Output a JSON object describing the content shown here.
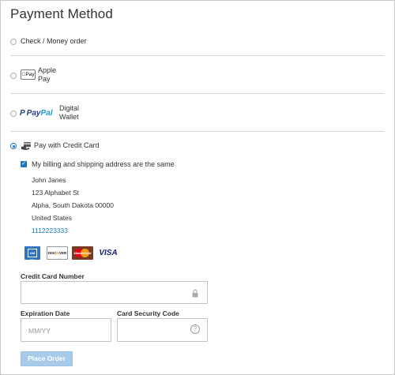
{
  "page": {
    "title": "Payment Method"
  },
  "methods": [
    {
      "label": "Check / Money order",
      "selected": false
    },
    {
      "label_line1": "Apple",
      "label_line2": "Pay",
      "logo_text": "Pay",
      "selected": false
    },
    {
      "label_line1": "Digital",
      "label_line2": "Wallet",
      "logo_text_1": "Pay",
      "logo_text_2": "Pal",
      "selected": false
    },
    {
      "label": "Pay with Credit Card",
      "selected": true
    }
  ],
  "billing": {
    "same_address_label": "My billing and shipping address are the same",
    "same_address_checked": true,
    "address": {
      "name": "John Janes",
      "street": "123 Alphabet St",
      "city_state_zip": "Alpha, South Dakota 00000",
      "country": "United States",
      "phone": "1112223333"
    }
  },
  "cards": {
    "amex_text": "AM EX",
    "discover_text_a": "DISC",
    "discover_text_b": "O",
    "discover_text_c": "VER",
    "mastercard_text": "MasterCard",
    "visa_text": "VISA"
  },
  "form": {
    "card_number_label": "Credit Card Number",
    "card_number_value": "",
    "expiration_label": "Expiration Date",
    "expiration_placeholder": "MM/YY",
    "security_label": "Card Security Code",
    "security_help": "?",
    "submit_label": "Place Order"
  },
  "colors": {
    "accent": "#1979c3",
    "button_disabled": "#a9cbea"
  }
}
